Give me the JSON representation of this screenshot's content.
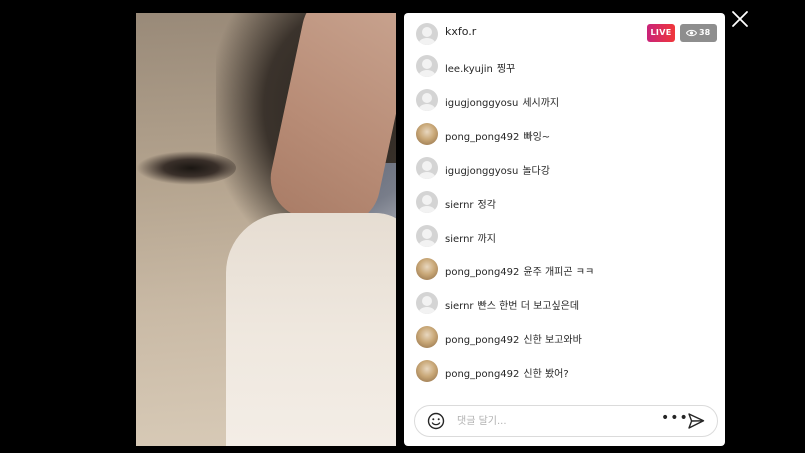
{
  "header": {
    "host": "kxfo.r",
    "live_badge": "LIVE",
    "viewer_count": "38"
  },
  "comments": [
    {
      "user": "lee.kyujin",
      "text": "찡꾸",
      "avatar": "default"
    },
    {
      "user": "igugjonggyosu",
      "text": "세시까지",
      "avatar": "default"
    },
    {
      "user": "pong_pong492",
      "text": "빠잉~",
      "avatar": "photo"
    },
    {
      "user": "igugjonggyosu",
      "text": "놀다강",
      "avatar": "default"
    },
    {
      "user": "siernr",
      "text": "정각",
      "avatar": "default"
    },
    {
      "user": "siernr",
      "text": "까지",
      "avatar": "default"
    },
    {
      "user": "pong_pong492",
      "text": "윤주 개피곤 ㅋㅋ",
      "avatar": "photo"
    },
    {
      "user": "siernr",
      "text": "빤스 한번 더 보고싶은데",
      "avatar": "default"
    },
    {
      "user": "pong_pong492",
      "text": "신한 보고와바",
      "avatar": "photo"
    },
    {
      "user": "pong_pong492",
      "text": "신한 봤어?",
      "avatar": "photo"
    }
  ],
  "composer": {
    "placeholder": "댓글 달기...",
    "more_label": "•••"
  }
}
